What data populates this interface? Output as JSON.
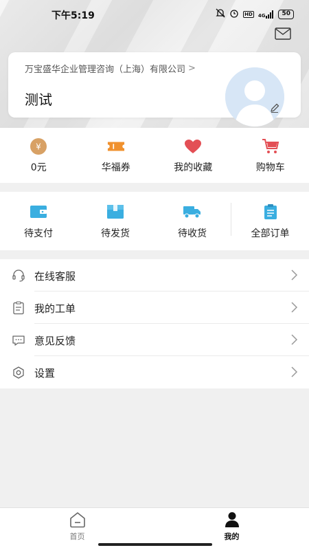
{
  "status_bar": {
    "time": "下午5:19",
    "signal_label": "4G",
    "battery": "50"
  },
  "profile": {
    "company": "万宝盛华企业管理咨询（上海）有限公司",
    "company_chevron": ">",
    "name": "测试",
    "avatar_icon": "default-avatar-icon",
    "edit_icon": "pencil-icon"
  },
  "header": {
    "mail_icon": "mail-icon"
  },
  "quick": [
    {
      "label": "0元",
      "icon": "yuan-coin-icon",
      "color": "#d8a165"
    },
    {
      "label": "华福券",
      "icon": "coupon-icon",
      "color": "#f0912e"
    },
    {
      "label": "我的收藏",
      "icon": "heart-icon",
      "color": "#e34f55"
    },
    {
      "label": "购物车",
      "icon": "cart-icon",
      "color": "#e34f55"
    }
  ],
  "orders": [
    {
      "label": "待支付",
      "icon": "wallet-icon"
    },
    {
      "label": "待发货",
      "icon": "box-icon"
    },
    {
      "label": "待收货",
      "icon": "truck-icon"
    },
    {
      "label": "全部订单",
      "icon": "clipboard-icon"
    }
  ],
  "order_icon_color": "#3aaee0",
  "menu": [
    {
      "label": "在线客服",
      "icon": "headset-icon"
    },
    {
      "label": "我的工单",
      "icon": "clipboard-list-icon"
    },
    {
      "label": "意见反馈",
      "icon": "chat-icon"
    },
    {
      "label": "设置",
      "icon": "settings-icon"
    }
  ],
  "bottom_nav": [
    {
      "label": "首页",
      "icon": "home-icon",
      "active": false
    },
    {
      "label": "我的",
      "icon": "user-icon",
      "active": true
    }
  ]
}
